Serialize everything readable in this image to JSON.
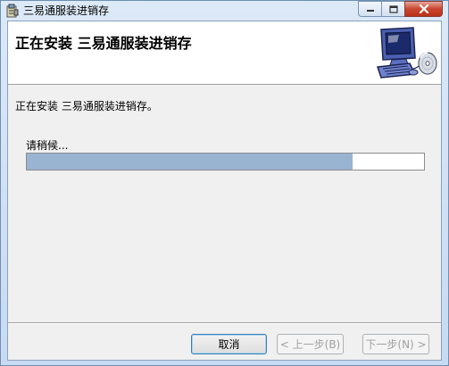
{
  "window": {
    "title": "三易通服装进销存"
  },
  "banner": {
    "title": "正在安装 三易通服装进销存"
  },
  "body": {
    "status_text": "正在安装 三易通服装进销存。",
    "wait_text": "请稍候...",
    "progress_percent": 82
  },
  "buttons": {
    "cancel": "取消",
    "back": "< 上一步(B)",
    "next": "下一步(N) >"
  },
  "icons": {
    "app": "installer-icon",
    "banner": "computer-cd-icon",
    "minimize": "minimize-icon",
    "maximize": "maximize-icon",
    "close": "close-icon"
  },
  "colors": {
    "progress_fill": "#99b4d1",
    "client_bg": "#f0f0f0",
    "close_button": "#c9462f"
  }
}
